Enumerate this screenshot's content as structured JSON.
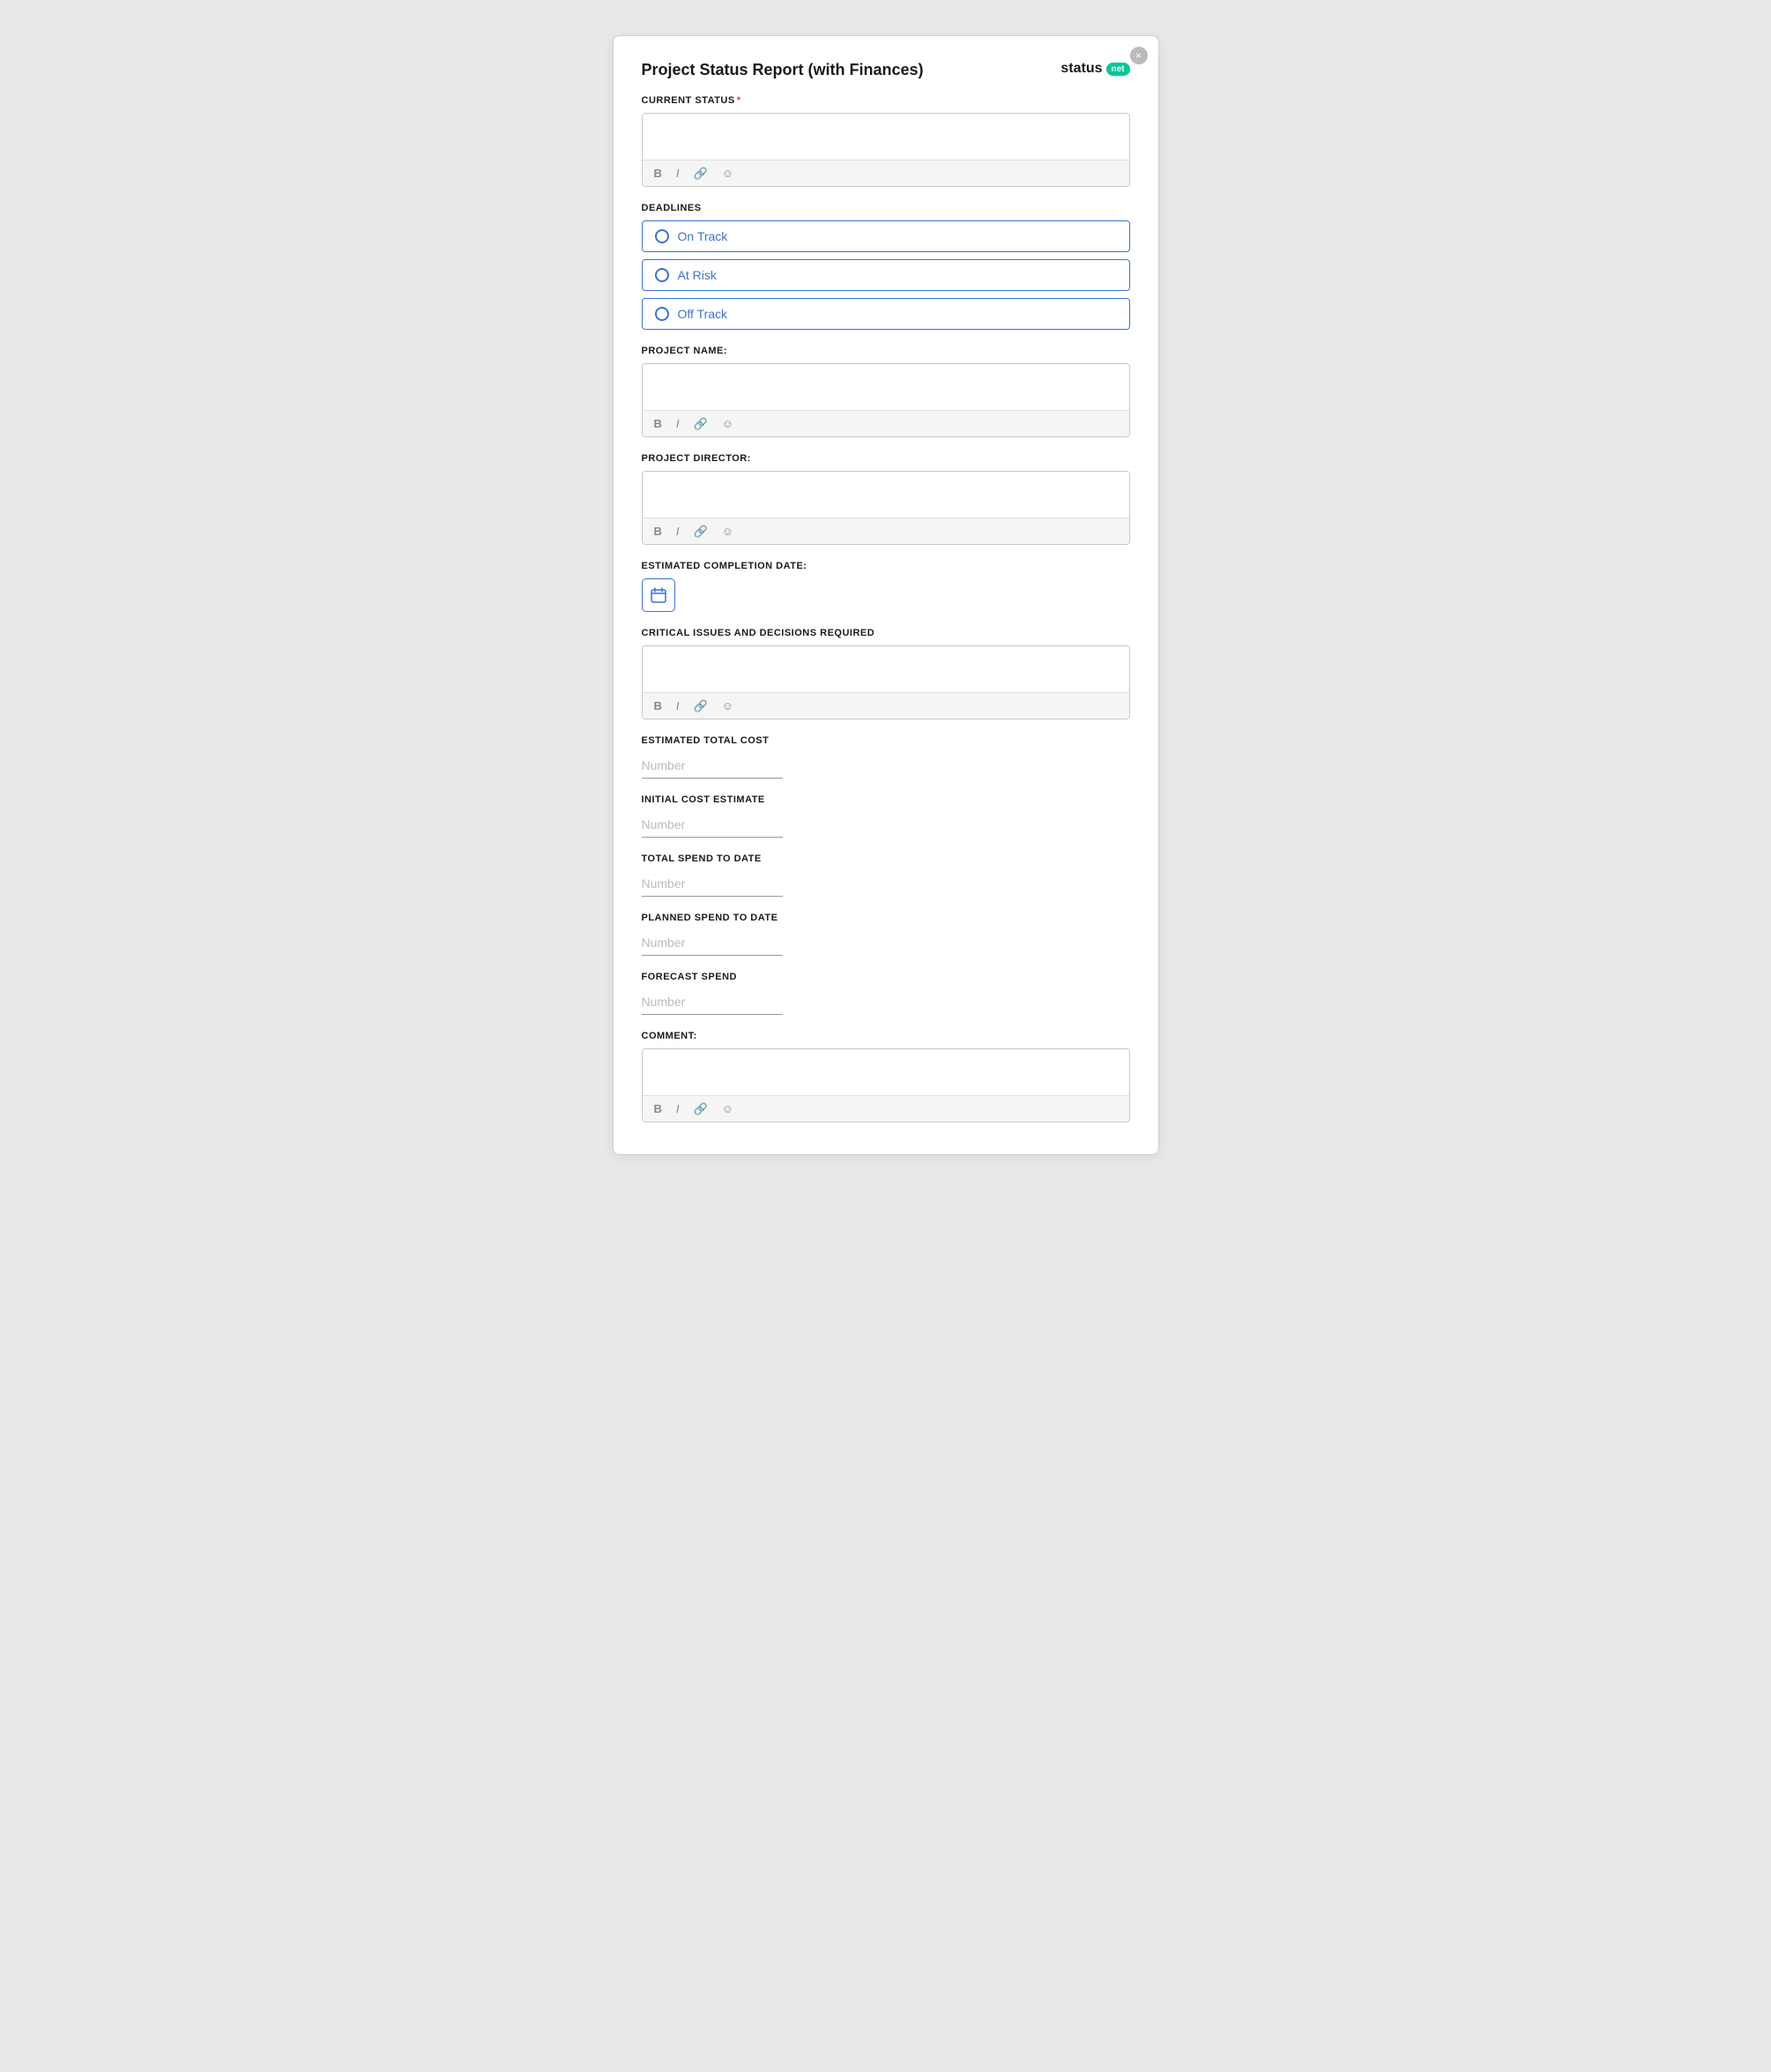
{
  "modal": {
    "title": "Project Status Report (with Finances)",
    "close_label": "×"
  },
  "brand": {
    "name": "status",
    "badge": "net"
  },
  "fields": {
    "current_status": {
      "label": "CURRENT STATUS",
      "required": true
    },
    "deadlines": {
      "label": "DEADLINES",
      "options": [
        {
          "value": "on-track",
          "label": "On Track"
        },
        {
          "value": "at-risk",
          "label": "At Risk"
        },
        {
          "value": "off-track",
          "label": "Off Track"
        }
      ]
    },
    "project_name": {
      "label": "PROJECT NAME:"
    },
    "project_director": {
      "label": "PROJECT DIRECTOR:"
    },
    "estimated_completion_date": {
      "label": "ESTIMATED COMPLETION DATE:"
    },
    "critical_issues": {
      "label": "CRITICAL ISSUES AND DECISIONS REQUIRED"
    },
    "estimated_total_cost": {
      "label": "ESTIMATED TOTAL COST",
      "placeholder": "Number"
    },
    "initial_cost_estimate": {
      "label": "INITIAL COST ESTIMATE",
      "placeholder": "Number"
    },
    "total_spend_to_date": {
      "label": "TOTAL SPEND TO DATE",
      "placeholder": "Number"
    },
    "planned_spend_to_date": {
      "label": "PLANNED SPEND TO DATE",
      "placeholder": "Number"
    },
    "forecast_spend": {
      "label": "FORECAST SPEND",
      "placeholder": "Number"
    },
    "comment": {
      "label": "COMMENT:"
    }
  },
  "toolbar": {
    "bold": "B",
    "italic": "I",
    "link": "🔗",
    "emoji": "☺"
  }
}
